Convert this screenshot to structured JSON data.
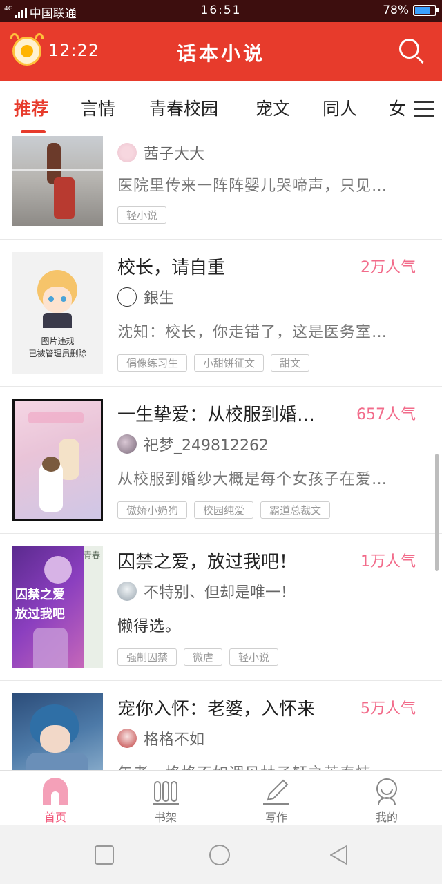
{
  "status_bar": {
    "network": "4G",
    "carrier": "中国联通",
    "time": "16:51",
    "battery": "78%",
    "battery_level": 0.78
  },
  "header": {
    "time": "12:22",
    "title": "话本小说",
    "search_icon": "search-icon",
    "clock_icon": "alarm-clock-coin-icon"
  },
  "tabs": [
    {
      "label": "推荐",
      "active": true
    },
    {
      "label": "言情",
      "active": false
    },
    {
      "label": "青春校园",
      "active": false
    },
    {
      "label": "宠文",
      "active": false
    },
    {
      "label": "同人",
      "active": false
    },
    {
      "label": "女·",
      "active": false
    }
  ],
  "tab_menu_icon": "menu-icon",
  "stories": [
    {
      "title": "",
      "popularity": "",
      "author": "茜子大大",
      "description": "医院里传来一阵阵婴儿哭啼声，只见…",
      "tags": [
        "轻小说"
      ]
    },
    {
      "title": "校长，请自重",
      "popularity": "2万人气",
      "author": "銀生",
      "description": "沈知：校长，你走错了，这是医务室…",
      "tags": [
        "偶像练习生",
        "小甜饼征文",
        "甜文"
      ],
      "cover_text": [
        "图片违规",
        "已被管理员删除"
      ]
    },
    {
      "title": "一生挚爱：从校服到婚…",
      "popularity": "657人气",
      "author": "祀梦_249812262",
      "description": "从校服到婚纱大概是每个女孩子在爱…",
      "tags": [
        "傲娇小奶狗",
        "校园纯爱",
        "霸道总裁文"
      ]
    },
    {
      "title": "囚禁之爱，放过我吧！",
      "popularity": "1万人气",
      "author": "不特别、但却是唯一！",
      "description": "懒得选。",
      "tags": [
        "强制囚禁",
        "微虐",
        "轻小说"
      ],
      "cover_text": [
        "囚禁之爱",
        "放过我吧",
        "青春"
      ]
    },
    {
      "title": "宠你入怀：老婆，入怀来",
      "popularity": "5万人气",
      "author": "格格不如",
      "description": "年老，格格不如调见林子轩之芳春情…",
      "tags": []
    }
  ],
  "bottom_nav": [
    {
      "label": "首页",
      "icon": "home-icon",
      "active": true
    },
    {
      "label": "书架",
      "icon": "bookshelf-icon",
      "active": false
    },
    {
      "label": "写作",
      "icon": "pencil-icon",
      "active": false
    },
    {
      "label": "我的",
      "icon": "profile-icon",
      "active": false
    }
  ],
  "colors": {
    "primary": "#e73b2c",
    "popularity": "#f26b8a",
    "nav_active": "#f2567a"
  }
}
